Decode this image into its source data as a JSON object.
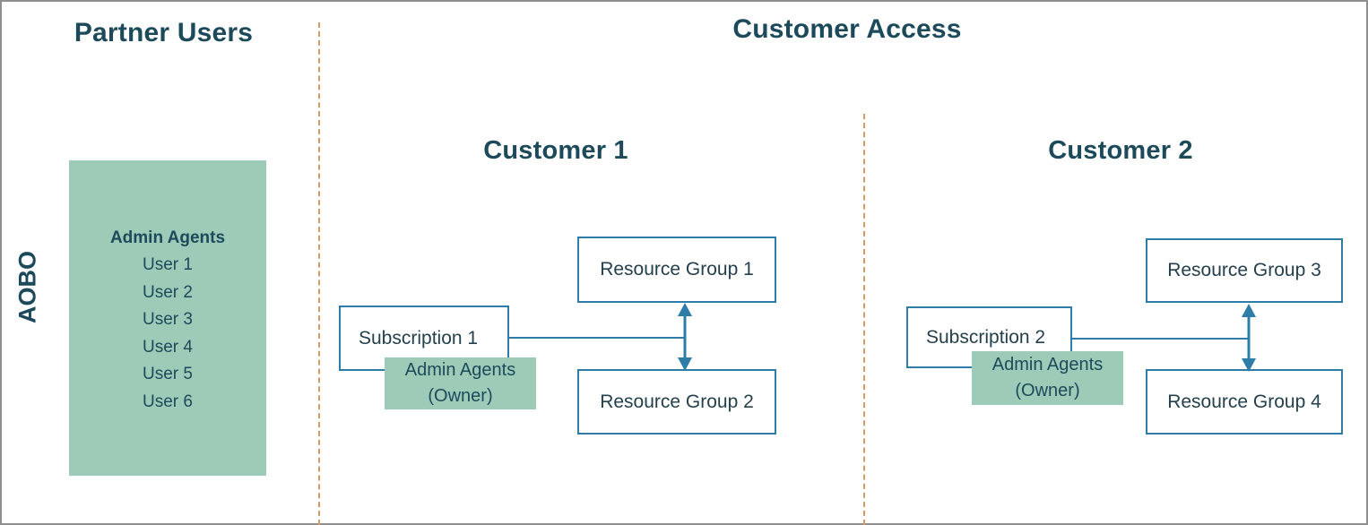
{
  "diagram": {
    "title_partner": "Partner Users",
    "title_customer_access": "Customer Access",
    "side_label": "AOBO"
  },
  "partner_panel": {
    "heading": "Admin Agents",
    "users": [
      "User 1",
      "User 2",
      "User 3",
      "User 4",
      "User 5",
      "User 6"
    ]
  },
  "customers": [
    {
      "title": "Customer 1",
      "subscription": "Subscription 1",
      "owner_chip": {
        "line1": "Admin Agents",
        "line2": "(Owner)"
      },
      "resource_groups": [
        "Resource Group 1",
        "Resource Group 2"
      ]
    },
    {
      "title": "Customer 2",
      "subscription": "Subscription 2",
      "owner_chip": {
        "line1": "Admin Agents",
        "line2": "(Owner)"
      },
      "resource_groups": [
        "Resource Group 3",
        "Resource Group 4"
      ]
    }
  ],
  "colors": {
    "accent_green": "#9ecbb8",
    "accent_blue": "#2e7ca8",
    "text_navy": "#1c4a5a",
    "divider_orange": "#d79a63",
    "box_text": "#24404d"
  }
}
